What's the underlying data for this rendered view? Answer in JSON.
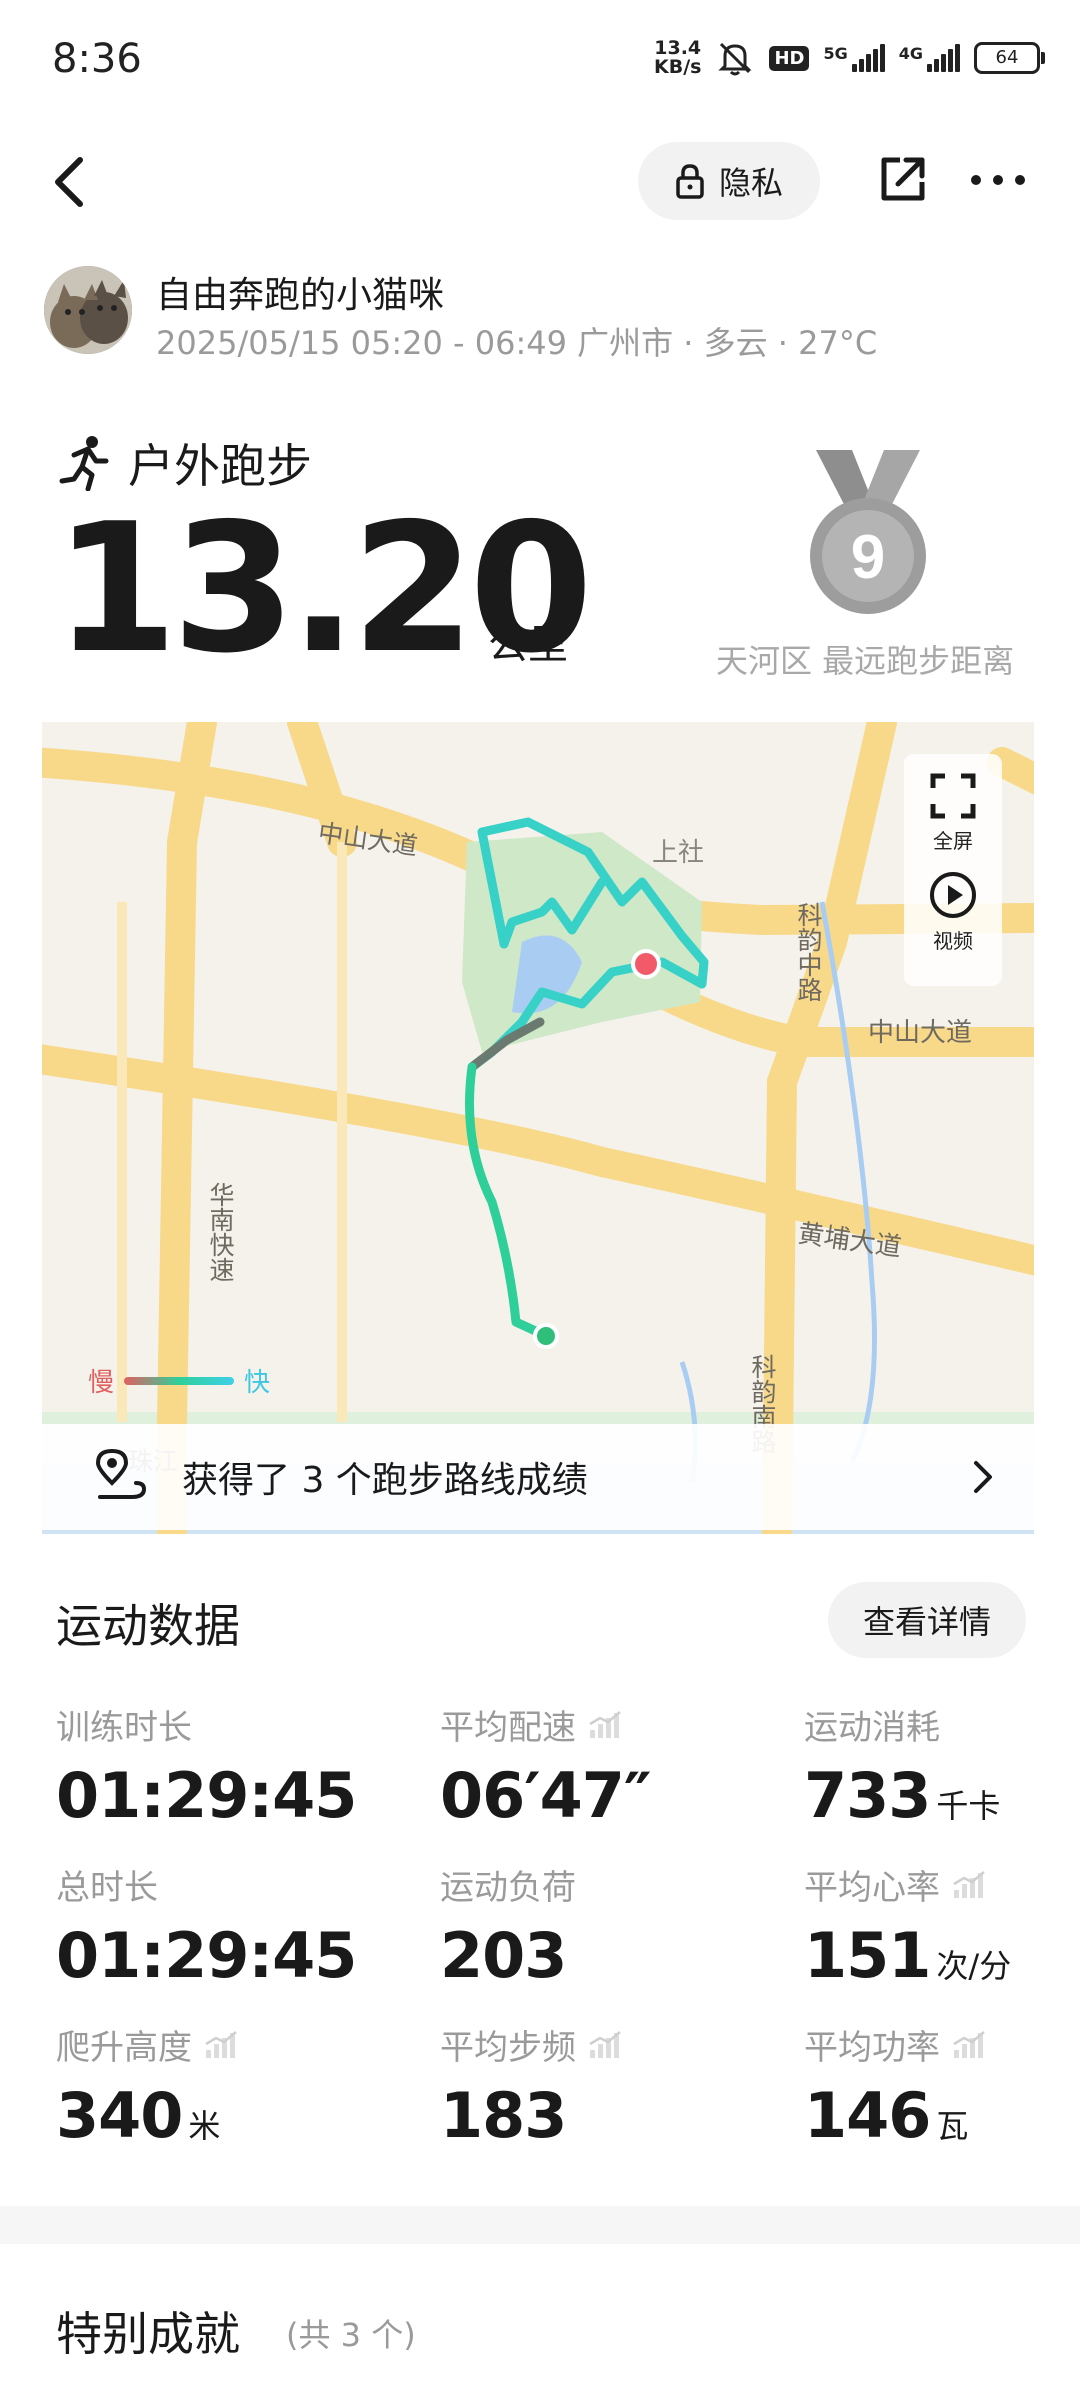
{
  "status_bar": {
    "time": "8:36",
    "net_speed_value": "13.4",
    "net_speed_unit": "KB/s",
    "hd_label": "HD",
    "sig1_label": "5G",
    "sig2_label": "4G",
    "battery": "64"
  },
  "header": {
    "privacy_label": "隐私"
  },
  "user": {
    "name": "自由奔跑的小猫咪",
    "meta": "2025/05/15 05:20 - 06:49 广州市 · 多云 · 27°C"
  },
  "activity": {
    "type": "户外跑步",
    "distance": "13.20",
    "distance_unit": "公里",
    "medal_number": "9",
    "medal_label": "天河区 最远跑步距离"
  },
  "map": {
    "fullscreen_label": "全屏",
    "video_label": "视频",
    "legend_slow": "慢",
    "legend_fast": "快",
    "route_achievement": "获得了 3 个跑步路线成绩",
    "labels": {
      "zhongshan_w": "中山大道",
      "shangshe": "上社",
      "keyun_n": "科韵中路",
      "zhongshan_e": "中山大道",
      "huanan": "华南快速",
      "huangpu": "黄埔大道",
      "keyun_s": "科韵南路",
      "zhujiang": "珠江"
    },
    "colors": {
      "slow": "#e06060",
      "fast": "#3ed0e8",
      "route": "#2fcf9a"
    }
  },
  "stats": {
    "title": "运动数据",
    "detail_button": "查看详情",
    "items": [
      {
        "label": "训练时长",
        "value": "01:29:45",
        "unit": ""
      },
      {
        "label": "平均配速",
        "value": "06′47″",
        "unit": ""
      },
      {
        "label": "运动消耗",
        "value": "733",
        "unit": "千卡"
      },
      {
        "label": "总时长",
        "value": "01:29:45",
        "unit": ""
      },
      {
        "label": "运动负荷",
        "value": "203",
        "unit": ""
      },
      {
        "label": "平均心率",
        "value": "151",
        "unit": "次/分"
      },
      {
        "label": "爬升高度",
        "value": "340",
        "unit": "米"
      },
      {
        "label": "平均步频",
        "value": "183",
        "unit": ""
      },
      {
        "label": "平均功率",
        "value": "146",
        "unit": "瓦"
      }
    ]
  },
  "achievements": {
    "title": "特别成就",
    "count": "(共 3 个)"
  }
}
